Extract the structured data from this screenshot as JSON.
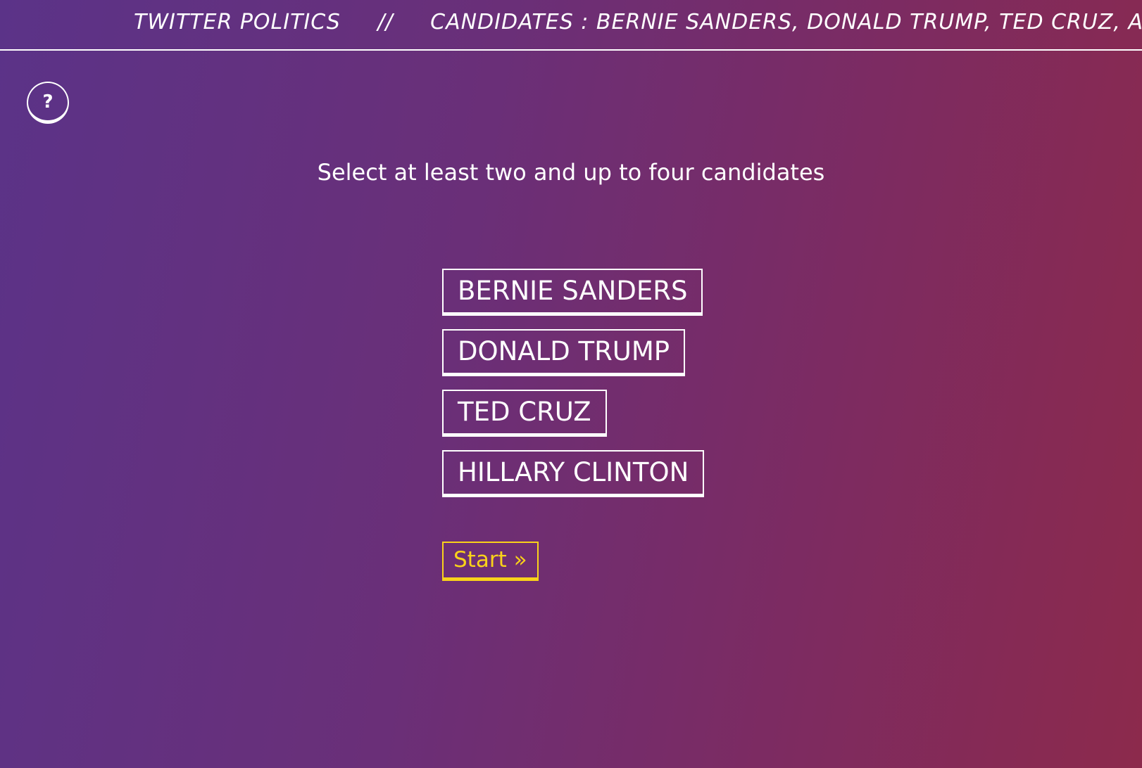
{
  "header": {
    "site_title": "TWITTER POLITICS",
    "separator": "//",
    "candidates_line": "CANDIDATES : BERNIE SANDERS, DONALD TRUMP, TED CRUZ, A"
  },
  "help_button": {
    "label": "?",
    "icon": "question-mark-icon"
  },
  "instruction": "Select at least two and up to four candidates",
  "candidates": [
    "BERNIE SANDERS",
    "DONALD TRUMP",
    "TED CRUZ",
    "HILLARY CLINTON"
  ],
  "start_button": {
    "label": "Start »"
  },
  "colors": {
    "accent": "#f9d21a",
    "text": "#ffffff",
    "gradient_start": "#5b3388",
    "gradient_end": "#8c2a4c"
  }
}
